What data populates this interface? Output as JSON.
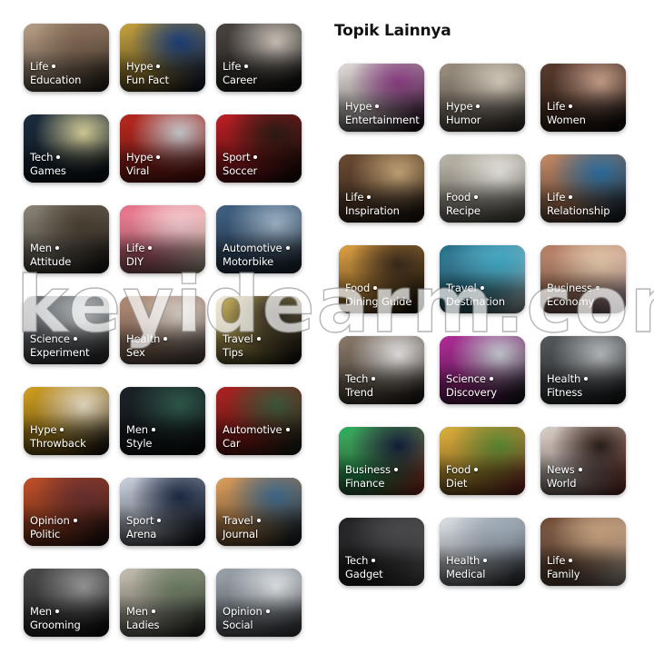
{
  "background_color": "#ffffff",
  "watermark": {
    "text": "keyidearm.com"
  },
  "left_panel": {
    "cards": [
      {
        "category": "Life",
        "subcategory": "Education",
        "image": "woman-in-hat-near-brown-wall"
      },
      {
        "category": "Hype",
        "subcategory": "Fun Fact",
        "image": "blue-gold-astronomical-clock"
      },
      {
        "category": "Life",
        "subcategory": "Career",
        "image": "woman-in-black-hijab"
      },
      {
        "category": "Tech",
        "subcategory": "Games",
        "image": "mobile-legends-on-tablet"
      },
      {
        "category": "Hype",
        "subcategory": "Viral",
        "image": "woman-red-hijab-sunglasses"
      },
      {
        "category": "Sport",
        "subcategory": "Soccer",
        "image": "football-team-red-kit"
      },
      {
        "category": "Men",
        "subcategory": "Attitude",
        "image": "man-in-grey-suit"
      },
      {
        "category": "Life",
        "subcategory": "DIY",
        "image": "colorful-handmade-plush"
      },
      {
        "category": "Automotive",
        "subcategory": "Motorbike",
        "image": "white-blue-motorbikes"
      },
      {
        "category": "Science",
        "subcategory": "Experiment",
        "image": "lab-glassware-experiment"
      },
      {
        "category": "Health",
        "subcategory": "Sex",
        "image": "couple-in-bed"
      },
      {
        "category": "Travel",
        "subcategory": "Tips",
        "image": "luggage-suitcase"
      },
      {
        "category": "Hype",
        "subcategory": "Throwback",
        "image": "retro-board-game-pieces"
      },
      {
        "category": "Men",
        "subcategory": "Style",
        "image": "young-man-black-blazer"
      },
      {
        "category": "Automotive",
        "subcategory": "Car",
        "image": "red-sports-car-mountain-road"
      },
      {
        "category": "Opinion",
        "subcategory": "Politic",
        "image": "crowd-at-rally"
      },
      {
        "category": "Sport",
        "subcategory": "Arena",
        "image": "badminton-player-celebrating"
      },
      {
        "category": "Travel",
        "subcategory": "Journal",
        "image": "lake-sunset-landscape"
      },
      {
        "category": "Men",
        "subcategory": "Grooming",
        "image": "bearded-man-black-white"
      },
      {
        "category": "Men",
        "subcategory": "Ladies",
        "image": "woman-walking-street"
      },
      {
        "category": "Opinion",
        "subcategory": "Social",
        "image": "laptop-and-phone-desk"
      }
    ]
  },
  "right_panel": {
    "title": "Topik Lainnya",
    "cards": [
      {
        "category": "Hype",
        "subcategory": "Entertainment",
        "image": "woman-white-cap-purple-bg"
      },
      {
        "category": "Hype",
        "subcategory": "Humor",
        "image": "man-sunglasses-street"
      },
      {
        "category": "Life",
        "subcategory": "Women",
        "image": "woman-portrait-dark"
      },
      {
        "category": "Life",
        "subcategory": "Inspiration",
        "image": "woman-hijab-mustard-top"
      },
      {
        "category": "Food",
        "subcategory": "Recipe",
        "image": "handwritten-recipe-notebook"
      },
      {
        "category": "Life",
        "subcategory": "Relationship",
        "image": "smiling-couple-sunglasses"
      },
      {
        "category": "Food",
        "subcategory": "Dining Guide",
        "image": "restaurant-candle-lights"
      },
      {
        "category": "Travel",
        "subcategory": "Destination",
        "image": "tropical-island-lagoon"
      },
      {
        "category": "Business",
        "subcategory": "Economy",
        "image": "stacked-banknotes"
      },
      {
        "category": "Tech",
        "subcategory": "Trend",
        "image": "white-humanoid-robot"
      },
      {
        "category": "Science",
        "subcategory": "Discovery",
        "image": "pipette-lab-tray"
      },
      {
        "category": "Health",
        "subcategory": "Fitness",
        "image": "dumbbell-rack-gym"
      },
      {
        "category": "Business",
        "subcategory": "Finance",
        "image": "stock-market-board"
      },
      {
        "category": "Food",
        "subcategory": "Diet",
        "image": "healthy-salad-bowl"
      },
      {
        "category": "News",
        "subcategory": "World",
        "image": "leader-in-traditional-attire"
      },
      {
        "category": "Tech",
        "subcategory": "Gadget",
        "image": "dark-desk-gadgets"
      },
      {
        "category": "Health",
        "subcategory": "Medical",
        "image": "microscopes-in-lab"
      },
      {
        "category": "Life",
        "subcategory": "Family",
        "image": "happy-family-lying-down"
      }
    ]
  }
}
